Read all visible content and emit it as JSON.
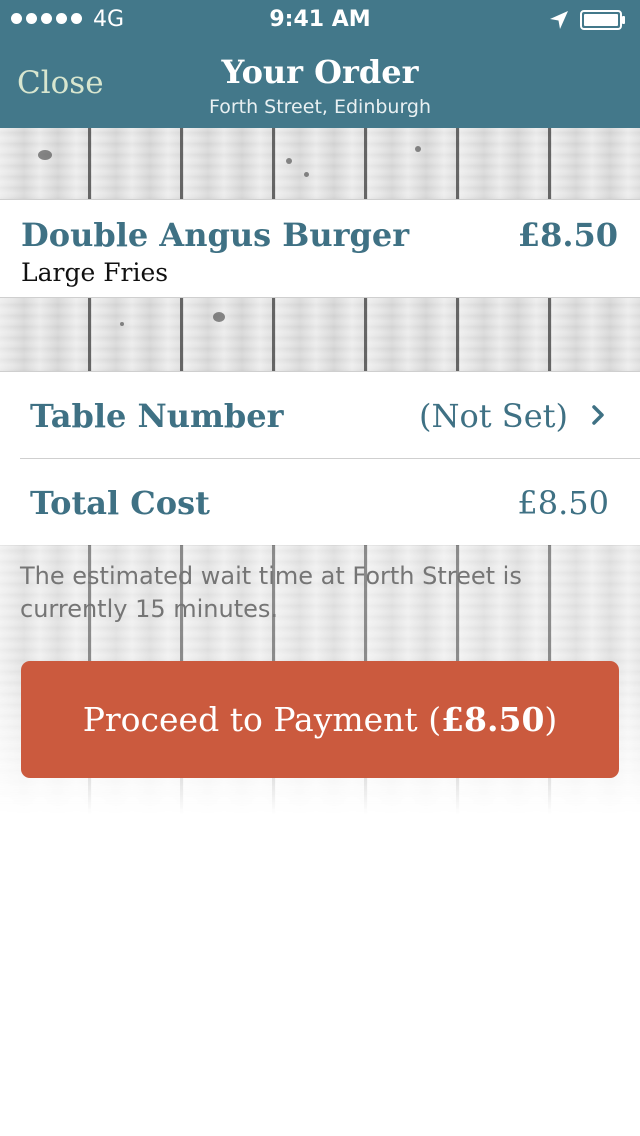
{
  "status_bar": {
    "carrier_signal_dots": 5,
    "network": "4G",
    "time": "9:41 AM",
    "icons": [
      "location-arrow-icon",
      "battery-icon"
    ]
  },
  "nav": {
    "close_label": "Close",
    "title": "Your Order",
    "subtitle": "Forth Street, Edinburgh"
  },
  "order": {
    "items": [
      {
        "name": "Double Angus Burger",
        "option": "Large Fries",
        "price": "£8.50"
      }
    ]
  },
  "summary": {
    "table_number_label": "Table Number",
    "table_number_value": "(Not Set)",
    "total_cost_label": "Total Cost",
    "total_cost_value": "£8.50"
  },
  "wait_note": "The estimated wait time at Forth Street is currently 15 minutes.",
  "payment_button": {
    "label": "Proceed to Payment",
    "open_paren": "(",
    "amount": "£8.50",
    "close_paren": ")"
  },
  "colors": {
    "nav_bar": "#43788a",
    "accent_text": "#3f7184",
    "close_text": "#d8e6cf",
    "pay_button": "#cb5a3e",
    "note_text": "#757575"
  }
}
